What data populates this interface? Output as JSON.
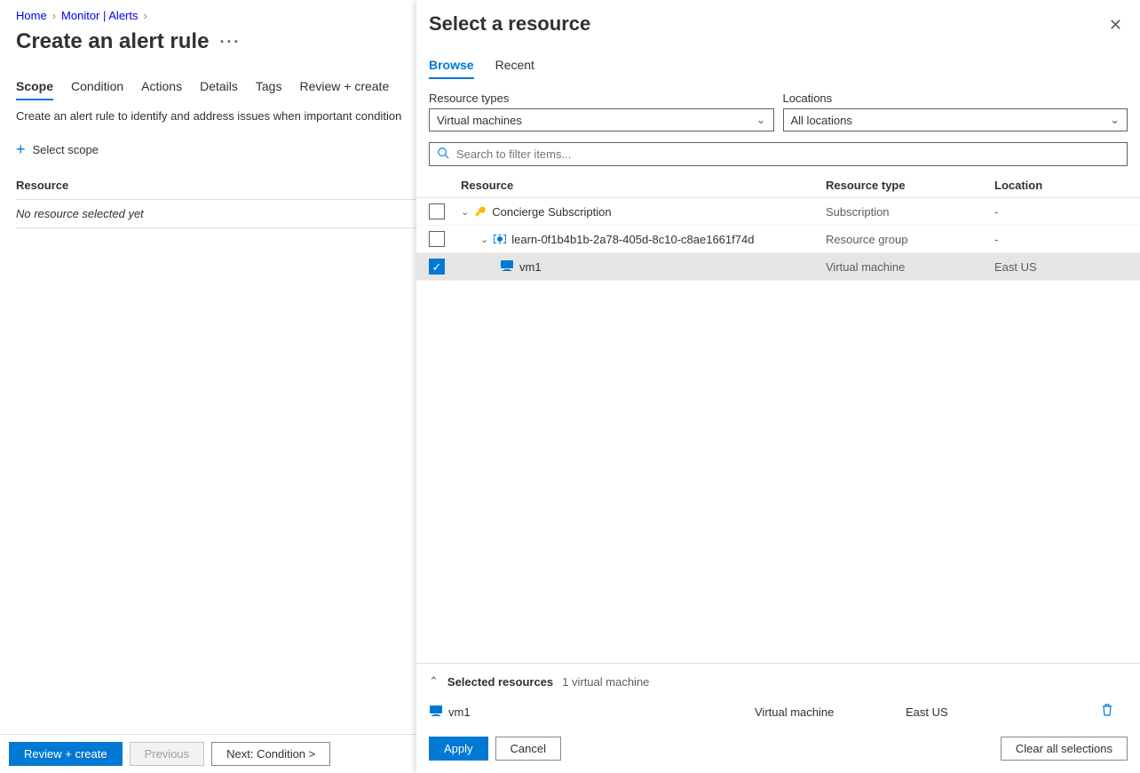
{
  "breadcrumb": {
    "home": "Home",
    "monitor": "Monitor | Alerts"
  },
  "page_title": "Create an alert rule",
  "tabs": [
    "Scope",
    "Condition",
    "Actions",
    "Details",
    "Tags",
    "Review + create"
  ],
  "desc": "Create an alert rule to identify and address issues when important condition",
  "select_scope_label": "Select scope",
  "resource_header": "Resource",
  "no_resource_text": "No resource selected yet",
  "footer": {
    "review_create": "Review + create",
    "previous": "Previous",
    "next": "Next: Condition >"
  },
  "panel": {
    "title": "Select a resource",
    "tabs": {
      "browse": "Browse",
      "recent": "Recent"
    },
    "filters": {
      "resource_types_label": "Resource types",
      "resource_types_value": "Virtual machines",
      "locations_label": "Locations",
      "locations_value": "All locations"
    },
    "search_placeholder": "Search to filter items...",
    "columns": {
      "resource": "Resource",
      "type": "Resource type",
      "location": "Location"
    },
    "rows": [
      {
        "name": "Concierge Subscription",
        "type": "Subscription",
        "location": "-",
        "indent": 1,
        "icon": "key",
        "checked": false
      },
      {
        "name": "learn-0f1b4b1b-2a78-405d-8c10-c8ae1661f74d",
        "type": "Resource group",
        "location": "-",
        "indent": 2,
        "icon": "rg",
        "checked": false
      },
      {
        "name": "vm1",
        "type": "Virtual machine",
        "location": "East US",
        "indent": 3,
        "icon": "vm",
        "checked": true
      }
    ],
    "selected": {
      "label": "Selected resources",
      "count_text": "1 virtual machine",
      "items": [
        {
          "name": "vm1",
          "type": "Virtual machine",
          "location": "East US"
        }
      ]
    },
    "actions": {
      "apply": "Apply",
      "cancel": "Cancel",
      "clear": "Clear all selections"
    }
  }
}
